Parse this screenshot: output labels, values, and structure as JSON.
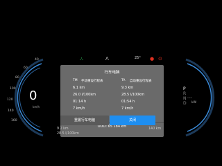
{
  "top_status": {
    "temperature": "25°",
    "icons": [
      "highbeam-icon",
      "road-icon",
      "seatbelt-icon",
      "brake-warning-icon"
    ]
  },
  "speedometer": {
    "speed": "0",
    "unit": "km/h",
    "ticks": [
      "20",
      "40",
      "60",
      "80",
      "100",
      "120",
      "140",
      "160"
    ]
  },
  "gear_selector": {
    "gears": [
      "P",
      "R",
      "N",
      "D"
    ],
    "active": "P",
    "range": "-----",
    "range_unit": "kW"
  },
  "dialog": {
    "title": "行车电脑",
    "tm_code": "TM",
    "tm_label": "手动重设行程表",
    "tm_distance": "6.1 km",
    "tm_consumption": "26.0 l/100km",
    "tm_time": "01:14 h",
    "tm_speed": "7 km/h",
    "ta_code": "TA",
    "ta_label": "自动重设行程表",
    "ta_distance": "9.3 km",
    "ta_consumption": "28.5 l/100km",
    "ta_time": "01:54 h",
    "ta_speed": "7 km/h",
    "odo": "ODO: 65 184 km",
    "reset_button": "重置行车电脑",
    "close_button": "关闭"
  },
  "bottom": {
    "distance": "9.2 km",
    "consumption": "28.5 l/100km",
    "range": "140 km"
  },
  "colors": {
    "accent": "#1e8ef0",
    "gauge_arc": "#3a8ad8",
    "warning": "#e03020",
    "green": "#2ec05a"
  }
}
